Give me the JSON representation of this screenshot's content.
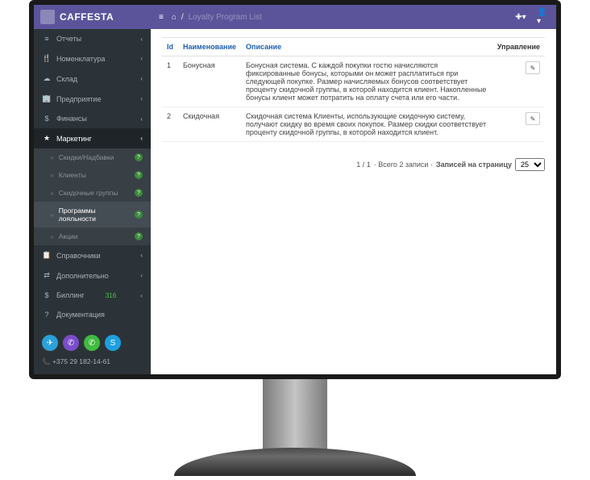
{
  "brand": "CAFFESTA",
  "breadcrumb": {
    "home": "⌂",
    "sep": "/",
    "current": "Loyalty Program List"
  },
  "sidebar": {
    "items": [
      {
        "icon": "≡",
        "label": "Отчеты"
      },
      {
        "icon": "🍴",
        "label": "Номенклатура"
      },
      {
        "icon": "☁",
        "label": "Склад"
      },
      {
        "icon": "🏢",
        "label": "Предприятие"
      },
      {
        "icon": "$",
        "label": "Финансы"
      },
      {
        "icon": "★",
        "label": "Маркетинг"
      },
      {
        "icon": "📋",
        "label": "Справочники"
      },
      {
        "icon": "⇄",
        "label": "Дополнительно"
      },
      {
        "icon": "$",
        "label": "Биллинг",
        "badge": "316"
      },
      {
        "icon": "?",
        "label": "Документация"
      }
    ],
    "subitems": [
      {
        "label": "Скидки/Надбавки"
      },
      {
        "label": "Клиенты"
      },
      {
        "label": "Скидочные группы"
      },
      {
        "label": "Программы лояльности"
      },
      {
        "label": "Акции"
      }
    ],
    "phone": "+375 29 182-14-61"
  },
  "table": {
    "headers": {
      "id": "Id",
      "name": "Наименование",
      "desc": "Описание",
      "manage": "Управление"
    },
    "rows": [
      {
        "id": "1",
        "name": "Бонусная",
        "desc": "Бонусная система. С каждой покупки гостю начисляются фиксированные бонусы, которыми он может расплатиться при следующей покупке. Размер начисляемых бонусов соответствует проценту скидочной группы, в которой находится клиент. Накопленные бонусы клиент может потратить на оплату счета или его части."
      },
      {
        "id": "2",
        "name": "Скидочная",
        "desc": "Скидочная система Клиенты, использующие скидочную систему, получают скидку во время своих покупок. Размер скидки соответствует проценту скидочной группы, в которой находится клиент."
      }
    ]
  },
  "pager": {
    "page": "1 / 1",
    "middle": "· Всего 2 записи ·",
    "label": "Записей на страницу",
    "perPage": "25"
  }
}
